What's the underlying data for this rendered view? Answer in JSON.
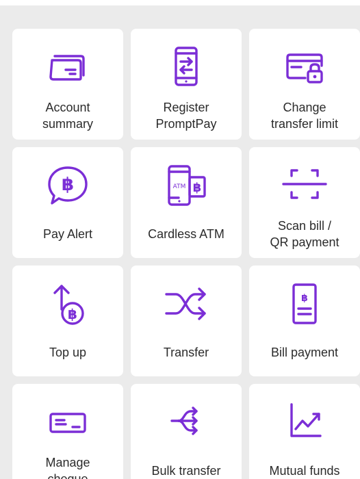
{
  "colors": {
    "accent": "#7b2ed6",
    "tile_bg": "#ffffff",
    "page_bg": "#ebebeb",
    "label_text": "#2b2b2b"
  },
  "menu": {
    "tiles": [
      {
        "id": "account-summary",
        "label": "Account\nsummary",
        "icon": "card-icon"
      },
      {
        "id": "register-promptpay",
        "label": "Register\nPromptPay",
        "icon": "phone-transfer-icon"
      },
      {
        "id": "change-transfer-limit",
        "label": "Change\ntransfer limit",
        "icon": "card-lock-icon"
      },
      {
        "id": "pay-alert",
        "label": "Pay Alert",
        "icon": "baht-chat-icon"
      },
      {
        "id": "cardless-atm",
        "label": "Cardless ATM",
        "icon": "atm-phone-icon"
      },
      {
        "id": "scan-bill",
        "label": "Scan bill /\nQR payment",
        "icon": "scan-icon"
      },
      {
        "id": "top-up",
        "label": "Top up",
        "icon": "topup-icon"
      },
      {
        "id": "transfer",
        "label": "Transfer",
        "icon": "shuffle-icon"
      },
      {
        "id": "bill-payment",
        "label": "Bill payment",
        "icon": "bill-icon"
      },
      {
        "id": "manage-cheque",
        "label": "Manage\ncheque",
        "icon": "cheque-icon"
      },
      {
        "id": "bulk-transfer",
        "label": "Bulk transfer",
        "icon": "bulk-transfer-icon"
      },
      {
        "id": "mutual-funds",
        "label": "Mutual funds",
        "icon": "chart-up-icon"
      }
    ]
  },
  "icon_text": {
    "atm": "ATM",
    "baht": "฿"
  }
}
